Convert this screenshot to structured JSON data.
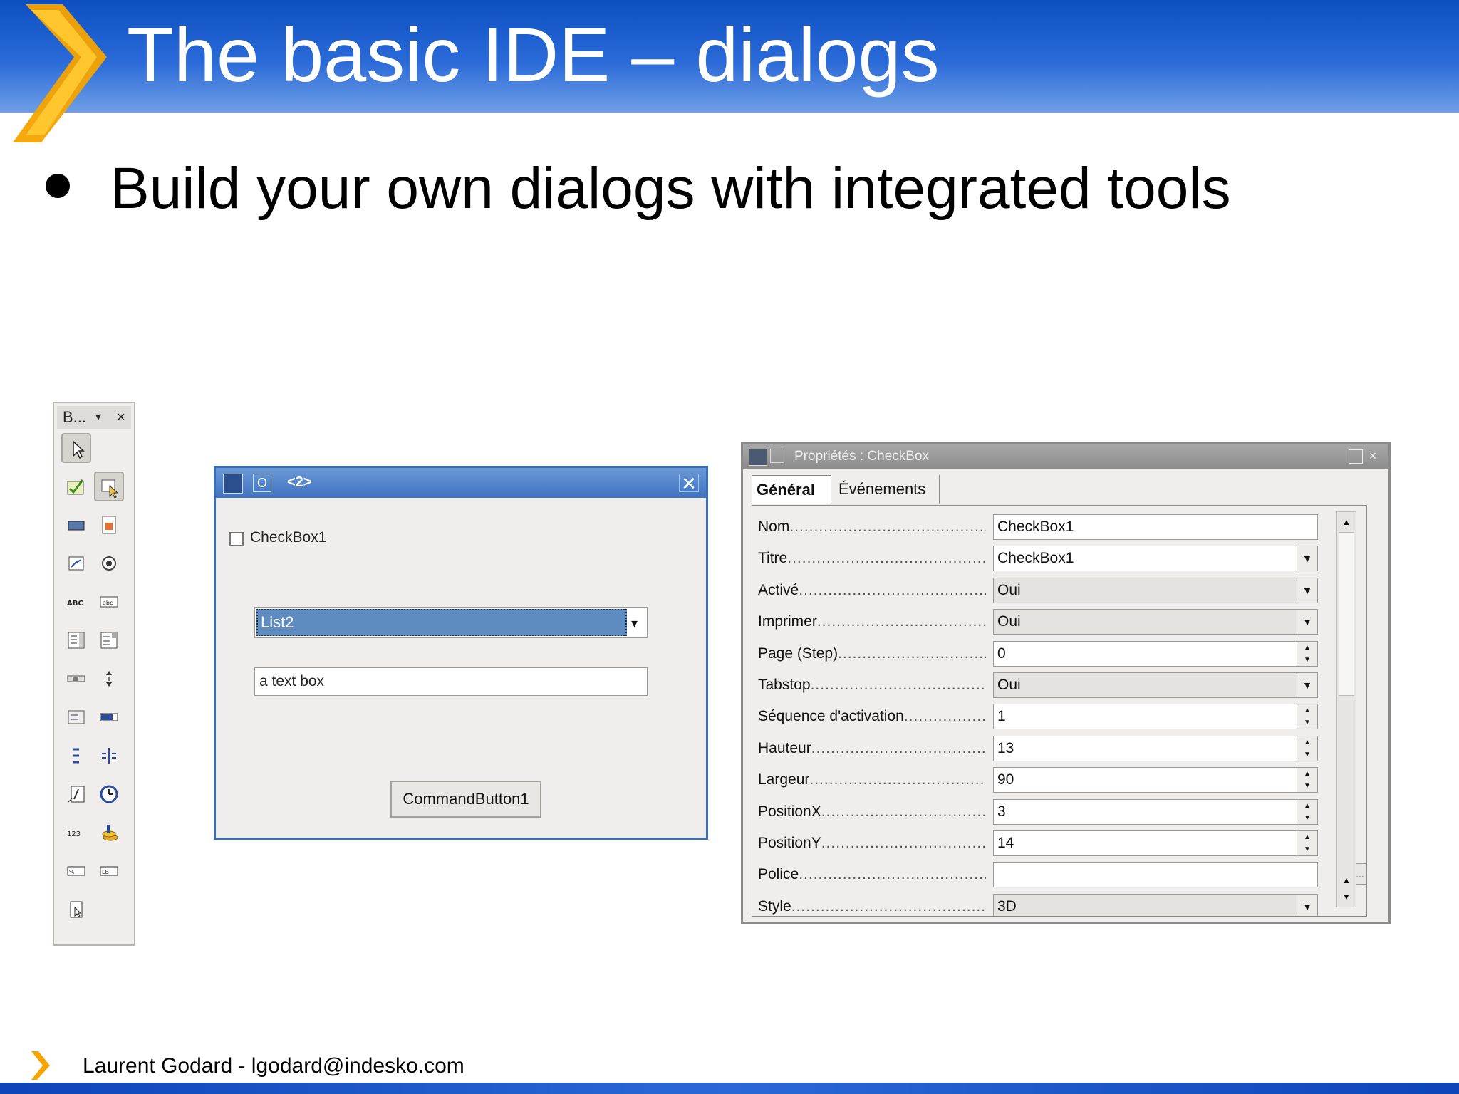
{
  "slide": {
    "title": "The basic IDE – dialogs",
    "bullet": "Build your own dialogs with integrated tools",
    "footer": "Laurent Godard - lgodard@indesko.com",
    "colors": {
      "header_blue": "#0d4fc2",
      "logo_orange": "#f5a400"
    }
  },
  "toolbox": {
    "title": "B...",
    "dropdown_icon": "▾",
    "close_icon": "×",
    "tools": [
      {
        "name": "select-tool",
        "icon": "pointer-icon"
      },
      {
        "name": "edit-mode-tool",
        "icon": "edit-form-icon"
      },
      {
        "name": "test-mode-tool",
        "icon": "test-mode-icon"
      },
      {
        "name": "button-tool",
        "icon": "button-icon"
      },
      {
        "name": "image-control-tool",
        "icon": "image-icon"
      },
      {
        "name": "checkbox-tool",
        "icon": "checkbox-icon"
      },
      {
        "name": "option-button-tool",
        "icon": "radio-icon"
      },
      {
        "name": "label-tool",
        "icon": "label-icon"
      },
      {
        "name": "text-box-tool",
        "icon": "textbox-icon"
      },
      {
        "name": "list-box-tool",
        "icon": "listbox-icon"
      },
      {
        "name": "combo-box-tool",
        "icon": "combobox-icon"
      },
      {
        "name": "horizontal-scrollbar-tool",
        "icon": "hscroll-icon"
      },
      {
        "name": "vertical-scrollbar-tool",
        "icon": "vscroll-icon"
      },
      {
        "name": "group-box-tool",
        "icon": "groupbox-icon"
      },
      {
        "name": "progress-bar-tool",
        "icon": "progressbar-icon"
      },
      {
        "name": "horizontal-line-tool",
        "icon": "hline-icon"
      },
      {
        "name": "vertical-line-tool",
        "icon": "vline-icon"
      },
      {
        "name": "date-field-tool",
        "icon": "date-icon"
      },
      {
        "name": "time-field-tool",
        "icon": "time-icon"
      },
      {
        "name": "numeric-field-tool",
        "icon": "numeric-icon"
      },
      {
        "name": "currency-field-tool",
        "icon": "currency-icon"
      },
      {
        "name": "formatted-field-tool",
        "icon": "formatted-icon"
      },
      {
        "name": "pattern-field-tool",
        "icon": "pattern-icon"
      },
      {
        "name": "file-selection-tool",
        "icon": "file-icon"
      }
    ]
  },
  "dialog": {
    "title": "<2>",
    "o_label": "O",
    "close_label": "✕",
    "checkbox_label": "CheckBox1",
    "list_value": "List2",
    "list_arrow": "▾",
    "textbox_value": "a text box",
    "button_label": "CommandButton1"
  },
  "properties": {
    "title": "Propriétés : CheckBox",
    "close_label": "×",
    "tabs": [
      "Général",
      "Événements"
    ],
    "dots": ".....................................................",
    "rows": [
      {
        "label": "Nom",
        "value": "CheckBox1",
        "control": "text"
      },
      {
        "label": "Titre",
        "value": "CheckBox1",
        "control": "combo-edit"
      },
      {
        "label": "Activé",
        "value": "Oui",
        "control": "combo"
      },
      {
        "label": "Imprimer",
        "value": "Oui",
        "control": "combo"
      },
      {
        "label": "Page (Step)",
        "value": "0",
        "control": "spin"
      },
      {
        "label": "Tabstop",
        "value": "Oui",
        "control": "combo"
      },
      {
        "label": "Séquence d'activation",
        "value": "1",
        "control": "spin"
      },
      {
        "label": "Hauteur",
        "value": "13",
        "control": "spin"
      },
      {
        "label": "Largeur",
        "value": "90",
        "control": "spin"
      },
      {
        "label": "PositionX",
        "value": "3",
        "control": "spin"
      },
      {
        "label": "PositionY",
        "value": "14",
        "control": "spin"
      },
      {
        "label": "Police",
        "value": "",
        "control": "dialog"
      },
      {
        "label": "Style",
        "value": "3D",
        "control": "combo"
      }
    ],
    "police_button": "...",
    "combo_arrow": "▼",
    "spin_up": "▲",
    "spin_down": "▼"
  }
}
